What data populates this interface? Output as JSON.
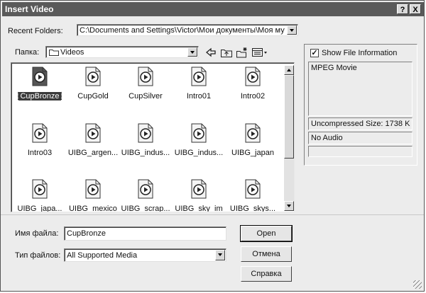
{
  "window": {
    "title": "Insert Video",
    "help_button": "?",
    "close_button": "X"
  },
  "recent": {
    "label": "Recent Folders:",
    "value": "C:\\Documents and Settings\\Victor\\Мои документы\\Моя муз"
  },
  "lookin": {
    "label": "Папка:",
    "value": "Videos"
  },
  "toolbar": {
    "icons": [
      "back-icon",
      "up-folder-icon",
      "new-folder-icon",
      "view-menu-icon"
    ]
  },
  "files": [
    {
      "name": "CupBronze",
      "selected": true
    },
    {
      "name": "CupGold"
    },
    {
      "name": "CupSilver"
    },
    {
      "name": "Intro01"
    },
    {
      "name": "Intro02"
    },
    {
      "name": "Intro03"
    },
    {
      "name": "UIBG_argen..."
    },
    {
      "name": "UIBG_indus..."
    },
    {
      "name": "UIBG_indus..."
    },
    {
      "name": "UIBG_japan"
    },
    {
      "name": "UIBG_japa..."
    },
    {
      "name": "UIBG_mexico"
    },
    {
      "name": "UIBG_scrap..."
    },
    {
      "name": "UIBG_sky_im"
    },
    {
      "name": "UIBG_skys..."
    }
  ],
  "info": {
    "show_label": "Show File Information",
    "checked": true,
    "file_type": "MPEG Movie",
    "size": "Uncompressed Size: 1738 K",
    "audio": "No Audio",
    "extra": ""
  },
  "filename": {
    "label": "Имя файла:",
    "value": "CupBronze"
  },
  "filetype": {
    "label": "Тип файлов:",
    "value": "All Supported Media"
  },
  "buttons": {
    "open": "Open",
    "cancel": "Отмена",
    "help": "Справка"
  },
  "colors": {
    "titlebar": "#5a5a5a",
    "dialog": "#ececec",
    "selection": "#3a3a3a"
  }
}
